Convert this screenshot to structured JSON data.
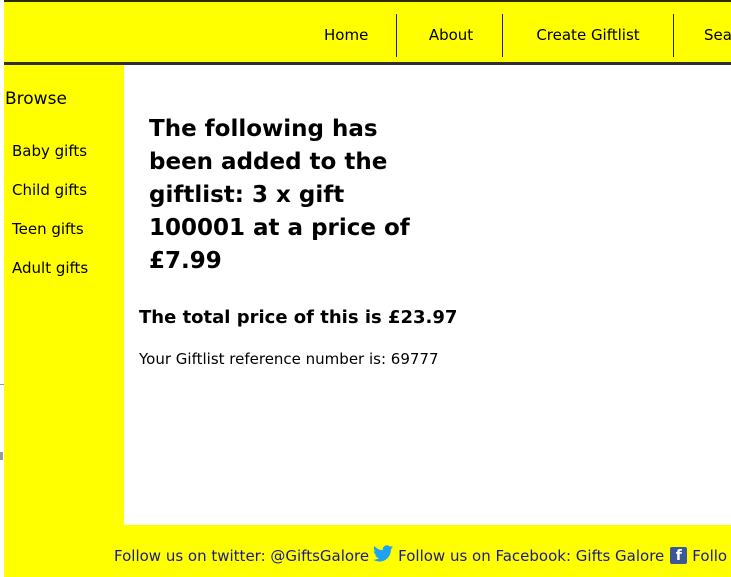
{
  "nav": {
    "items": [
      "Home",
      "About",
      "Create Giftlist",
      "Sea"
    ]
  },
  "sidebar": {
    "title": "Browse",
    "items": [
      "Baby gifts",
      "Child gifts",
      "Teen gifts",
      "Adult gifts"
    ]
  },
  "main": {
    "added_message": "The following has been added to the giftlist: 3 x gift 100001 at a price of £7.99",
    "total_text": "The total price of this is £23.97",
    "reference_text": "Your Giftlist reference number is: 69777"
  },
  "footer": {
    "twitter_text": "Follow us on twitter: @GiftsGalore",
    "facebook_text": "Follow us on Facebook: Gifts Galore",
    "trailing_text": "Follo",
    "twitter_icon": "twitter-bird-icon",
    "facebook_icon": "facebook-f-icon"
  },
  "colors": {
    "accent": "#ffff00",
    "footer_link": "#1a1a8c",
    "twitter": "#1da1f2",
    "facebook": "#3b5998"
  }
}
